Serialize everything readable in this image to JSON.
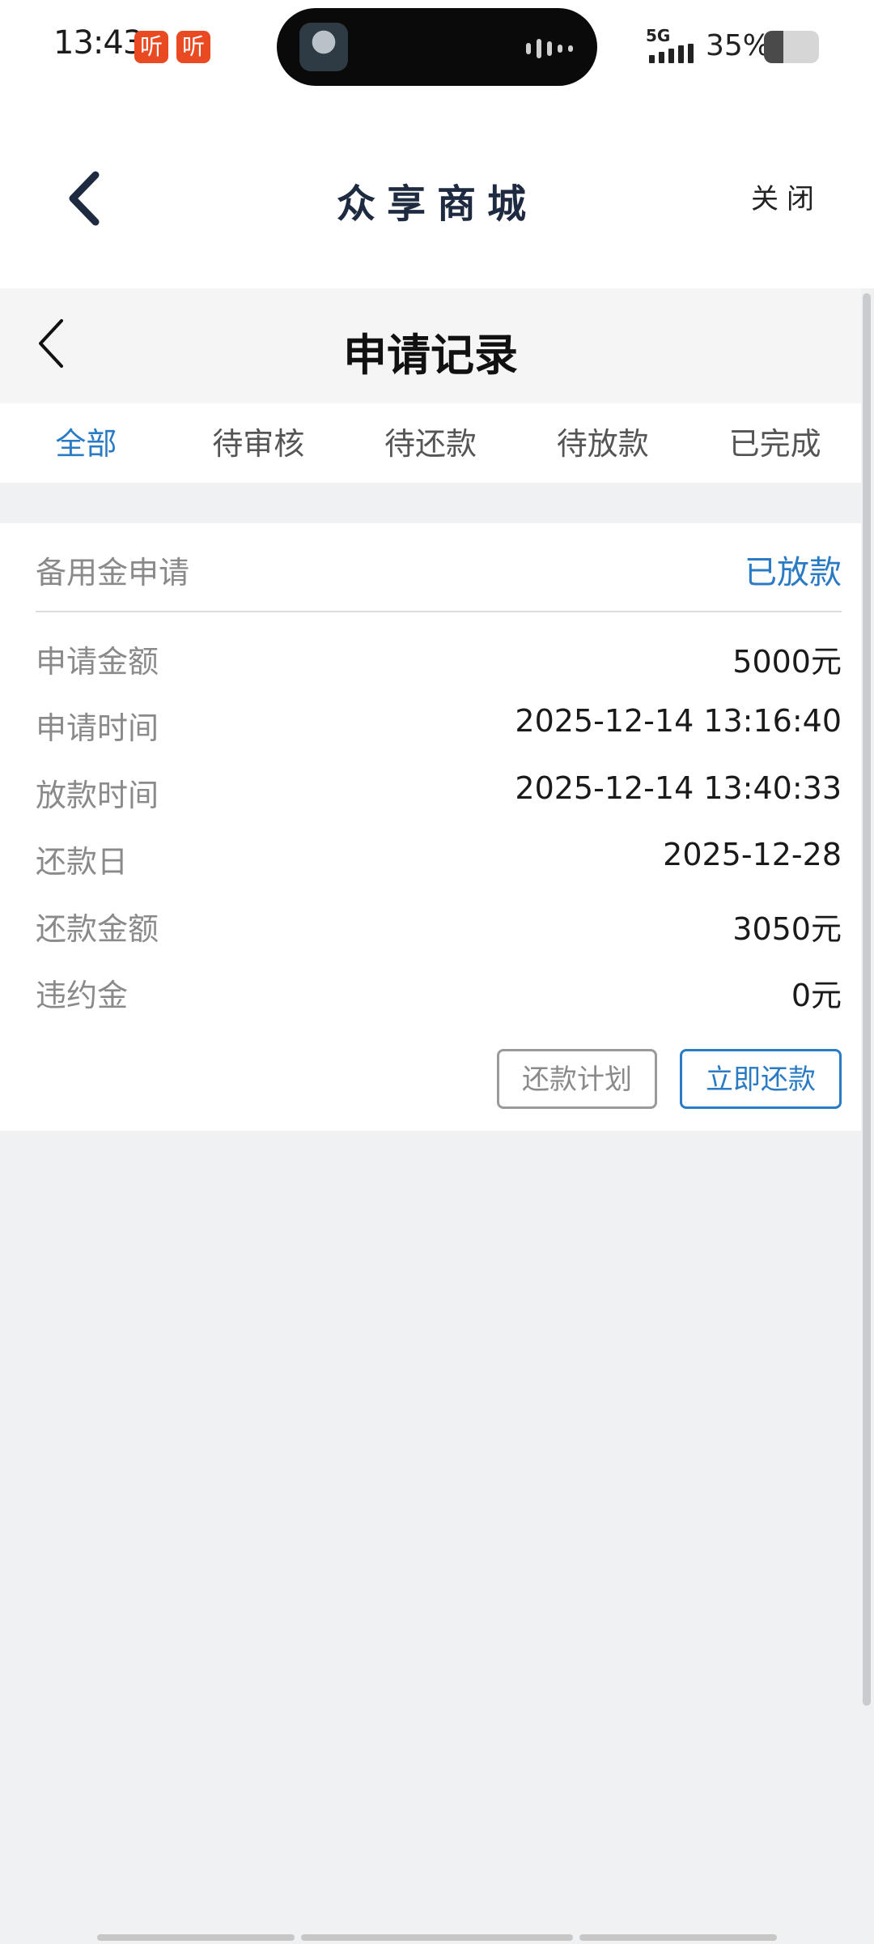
{
  "status_bar": {
    "time": "13:43",
    "badges": [
      "听",
      "听"
    ],
    "network": "5G",
    "battery": "35%",
    "battery_level": 0.35
  },
  "app_header": {
    "title": "众享商城",
    "close_label": "关闭"
  },
  "page": {
    "title": "申请记录",
    "tabs": [
      {
        "label": "全部",
        "active": true
      },
      {
        "label": "待审核",
        "active": false
      },
      {
        "label": "待还款",
        "active": false
      },
      {
        "label": "待放款",
        "active": false
      },
      {
        "label": "已完成",
        "active": false
      }
    ]
  },
  "record": {
    "type": "备用金申请",
    "status": "已放款",
    "rows": [
      {
        "label": "申请金额",
        "value": "5000元"
      },
      {
        "label": "申请时间",
        "value": "2025-12-14 13:16:40"
      },
      {
        "label": "放款时间",
        "value": "2025-12-14 13:40:33"
      },
      {
        "label": "还款日",
        "value": "2025-12-28"
      },
      {
        "label": "还款金额",
        "value": "3050元"
      },
      {
        "label": "违约金",
        "value": "0元"
      }
    ],
    "buttons": {
      "plan": "还款计划",
      "repay": "立即还款"
    }
  },
  "colors": {
    "accent": "#2a7bc4",
    "header_title": "#1e2a40",
    "badge": "#e94a22"
  }
}
